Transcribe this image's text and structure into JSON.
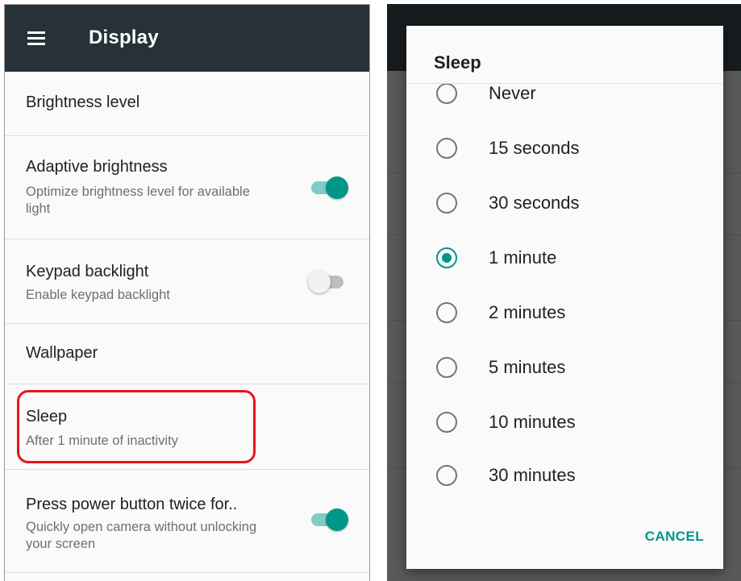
{
  "display_screen": {
    "title": "Display",
    "items": [
      {
        "title": "Brightness level",
        "subtitle": ""
      },
      {
        "title": "Adaptive brightness",
        "subtitle": "Optimize brightness level for available light",
        "toggle": "on"
      },
      {
        "title": "Keypad backlight",
        "subtitle": "Enable keypad backlight",
        "toggle": "off"
      },
      {
        "title": "Wallpaper",
        "subtitle": ""
      },
      {
        "title": "Sleep",
        "subtitle": "After 1 minute of inactivity"
      },
      {
        "title": "Press power button twice for..",
        "subtitle": "Quickly open camera without unlocking your screen",
        "toggle": "on"
      }
    ]
  },
  "sleep_dialog": {
    "title": "Sleep",
    "options": [
      {
        "label": "Never",
        "checked": false
      },
      {
        "label": "15 seconds",
        "checked": false
      },
      {
        "label": "30 seconds",
        "checked": false
      },
      {
        "label": "1 minute",
        "checked": true
      },
      {
        "label": "2 minutes",
        "checked": false
      },
      {
        "label": "5 minutes",
        "checked": false
      },
      {
        "label": "10 minutes",
        "checked": false
      },
      {
        "label": "30 minutes",
        "checked": false
      }
    ],
    "cancel_label": "CANCEL"
  },
  "colors": {
    "app_bar": "#263238",
    "accent": "#009688",
    "highlight": "#e8141c"
  }
}
